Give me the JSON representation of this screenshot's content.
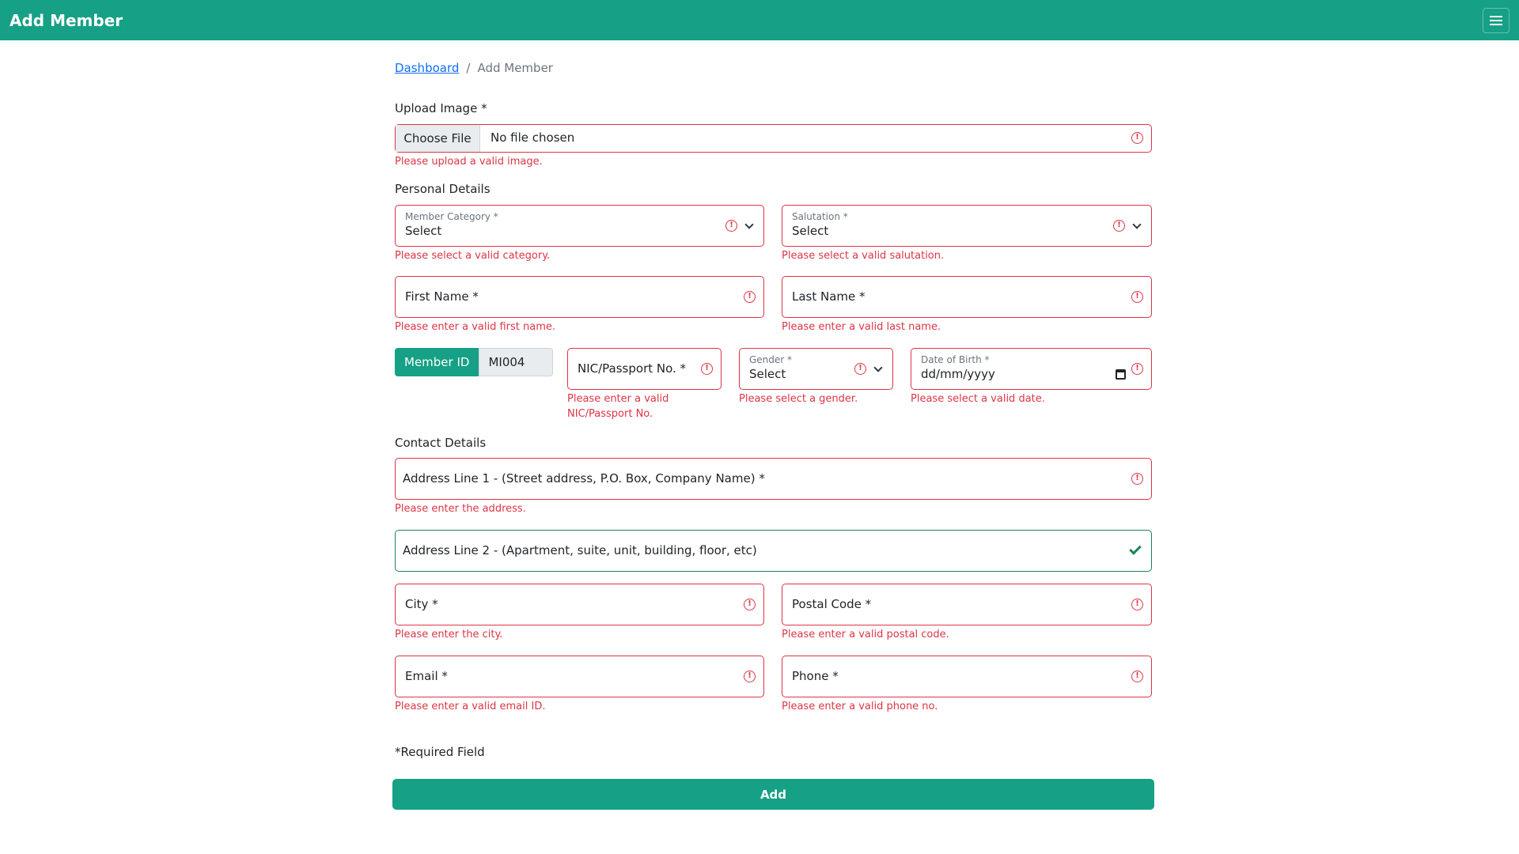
{
  "header": {
    "title": "Add Member",
    "menu_icon": "hamburger-icon"
  },
  "breadcrumb": {
    "link": "Dashboard",
    "separator": "/",
    "current": "Add Member"
  },
  "upload": {
    "label": "Upload Image *",
    "button": "Choose File",
    "status": "No file chosen",
    "error": "Please upload a valid image."
  },
  "personal": {
    "title": "Personal Details",
    "member_category": {
      "label": "Member Category *",
      "value": "Select",
      "error": "Please select a valid category."
    },
    "salutation": {
      "label": "Salutation *",
      "value": "Select",
      "error": "Please select a valid salutation."
    },
    "first_name": {
      "label": "First Name *",
      "error": "Please enter a valid first name."
    },
    "last_name": {
      "label": "Last Name *",
      "error": "Please enter a valid last name."
    },
    "member_id": {
      "label": "Member ID",
      "value": "MI004"
    },
    "nic": {
      "label": "NIC/Passport No. *",
      "error_line1": "Please enter a valid",
      "error_line2": "NIC/Passport No."
    },
    "gender": {
      "label": "Gender *",
      "value": "Select",
      "error": "Please select a gender."
    },
    "dob": {
      "label": "Date of Birth *",
      "value": "dd/mm/yyyy",
      "error": "Please select a valid date."
    }
  },
  "contact": {
    "title": "Contact Details",
    "address1": {
      "label": "Address Line 1 - (Street address, P.O. Box, Company Name) *",
      "error": "Please enter the address."
    },
    "address2": {
      "label": "Address Line 2 - (Apartment, suite, unit, building, floor, etc)"
    },
    "city": {
      "label": "City *",
      "error": "Please enter the city."
    },
    "postal": {
      "label": "Postal Code *",
      "error": "Please enter a valid postal code."
    },
    "email": {
      "label": "Email *",
      "error": "Please enter a valid email ID."
    },
    "phone": {
      "label": "Phone *",
      "error": "Please enter a valid phone no."
    }
  },
  "footer": {
    "required_note": "*Required Field",
    "submit_label": "Add"
  },
  "colors": {
    "primary": "#16a085",
    "error": "#dc3545",
    "valid": "#198754"
  }
}
